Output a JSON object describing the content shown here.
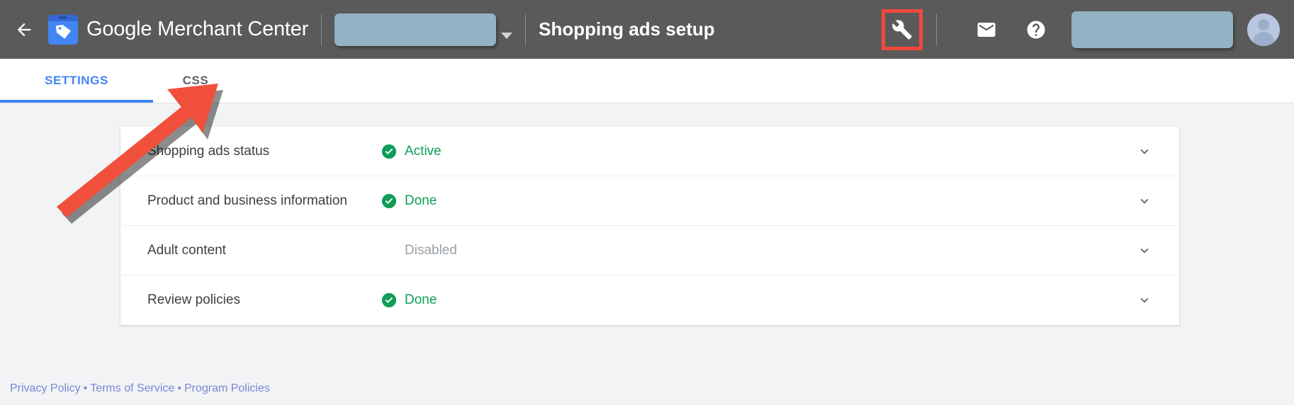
{
  "header": {
    "back_icon": "back-arrow-icon",
    "logo_icon": "merchant-center-logo-icon",
    "brand_bold": "Google",
    "brand_light": " Merchant Center",
    "account_selector_value": "",
    "page_title": "Shopping ads setup",
    "wrench_icon": "wrench-icon",
    "mail_icon": "mail-icon",
    "help_icon": "help-question-icon",
    "topright_value": "",
    "avatar_icon": "user-avatar-icon",
    "highlight_color": "#f4483c"
  },
  "tabs": [
    {
      "label": "SETTINGS",
      "active": true
    },
    {
      "label": "CSS",
      "active": false
    }
  ],
  "card": {
    "rows": [
      {
        "label": "Shopping ads status",
        "status": "Active",
        "status_kind": "done",
        "icon": "check-circle-icon",
        "chevron": "chevron-down-icon"
      },
      {
        "label": "Product and business information",
        "status": "Done",
        "status_kind": "done",
        "icon": "check-circle-icon",
        "chevron": "chevron-down-icon"
      },
      {
        "label": "Adult content",
        "status": "Disabled",
        "status_kind": "muted",
        "icon": "",
        "chevron": "chevron-down-icon"
      },
      {
        "label": "Review policies",
        "status": "Done",
        "status_kind": "done",
        "icon": "check-circle-icon",
        "chevron": "chevron-down-icon"
      }
    ]
  },
  "footer": {
    "privacy": "Privacy Policy",
    "sep1": "•",
    "terms": "Terms of Service",
    "sep2": "•",
    "program": "Program Policies"
  },
  "annotations": {
    "arrow_color": "#f0503c",
    "arrow_target": "css-tab",
    "highlight_target": "wrench-icon"
  },
  "colors": {
    "header_bg": "#5a5a5a",
    "accent_blue": "#4285f4",
    "green": "#0f9d58",
    "page_bg": "#f1f3f4",
    "redaction": "#93b2c4"
  }
}
